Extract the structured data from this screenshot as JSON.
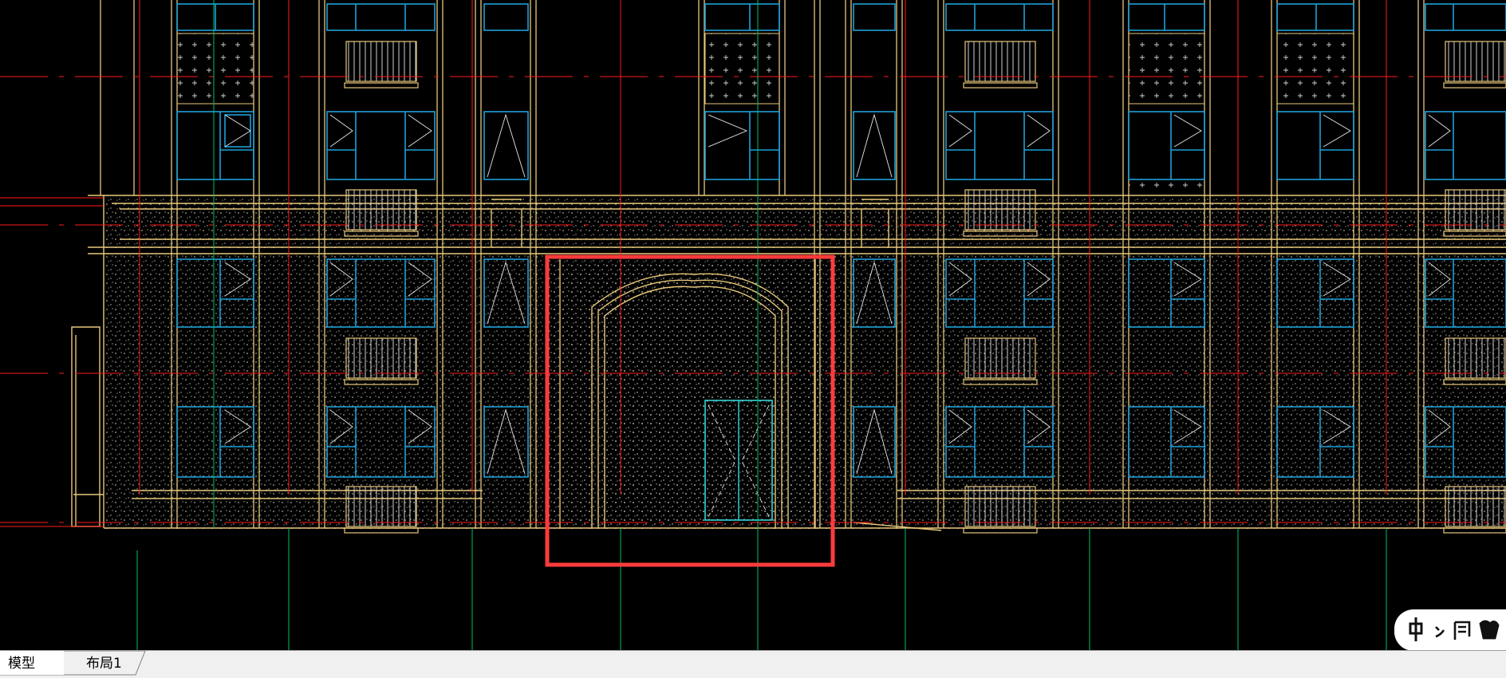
{
  "app": {
    "tabs": [
      {
        "label": "模型",
        "active": true
      },
      {
        "label": "布局1",
        "active": false
      }
    ]
  },
  "viewport": {
    "drawing": "building-front-elevation",
    "background_color": "#000000",
    "colors": {
      "outline": "#e8c77a",
      "window_frame": "#1e9fd8",
      "axis_red": "#ff1a1a",
      "axis_green": "#00c060",
      "door_frame": "#33d6d6",
      "selection": "#ff3333",
      "texture_dot": "#d8d8d8"
    },
    "selection_rect_color": "#ff3b3b"
  },
  "watermark": {
    "logo": "handwritten-calligraphy-seal"
  }
}
